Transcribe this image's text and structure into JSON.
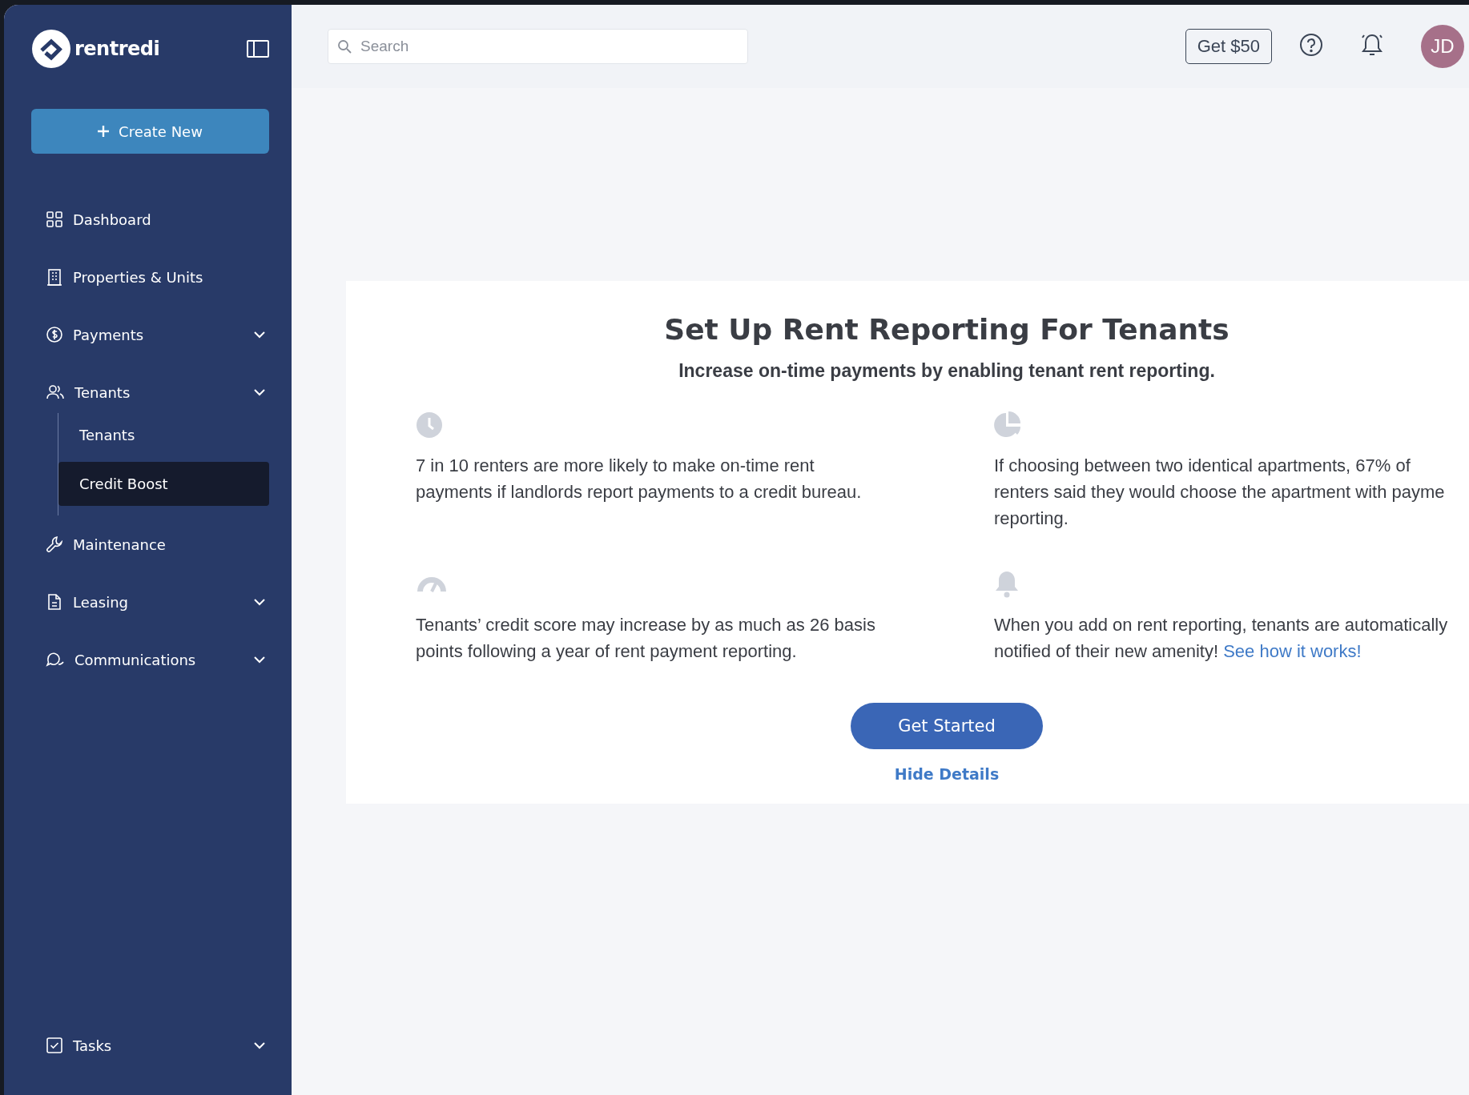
{
  "sidebar": {
    "logo": "rentredi",
    "create_button": "Create New",
    "nav": [
      {
        "label": "Dashboard",
        "has_menu": false
      },
      {
        "label": "Properties & Units",
        "has_menu": false
      },
      {
        "label": "Payments",
        "has_menu": true
      },
      {
        "label": "Tenants",
        "has_menu": true,
        "children": [
          {
            "label": "Tenants",
            "selected": false
          },
          {
            "label": "Credit Boost",
            "selected": true
          }
        ]
      },
      {
        "label": "Maintenance",
        "has_menu": false
      },
      {
        "label": "Leasing",
        "has_menu": true
      },
      {
        "label": "Communications",
        "has_menu": true
      }
    ],
    "footer_item": {
      "label": "Tasks",
      "has_menu": true
    }
  },
  "header": {
    "search": {
      "placeholder": "Search"
    },
    "reward_button": "Get $50",
    "avatar": "JD"
  },
  "card": {
    "title": "Set Up Rent Reporting For Tenants",
    "subtitle": "Increase on-time payments by enabling tenant rent reporting.",
    "features": [
      {
        "text": "7 in 10 renters are more likely to make on-time rent payments if landlords report payments to a credit bureau."
      },
      {
        "text": "If choosing between two identical apartments, 67% of renters said they would choose the apartment with payme reporting."
      },
      {
        "text": "Tenants’ credit score may increase by as much as 26 basis points following a year of rent payment reporting."
      },
      {
        "text": "When you add on rent reporting, tenants are automatically notified of their new amenity!",
        "link": "See how it works!"
      }
    ],
    "button": "Get Started",
    "secondary_link": "Hide Details"
  }
}
